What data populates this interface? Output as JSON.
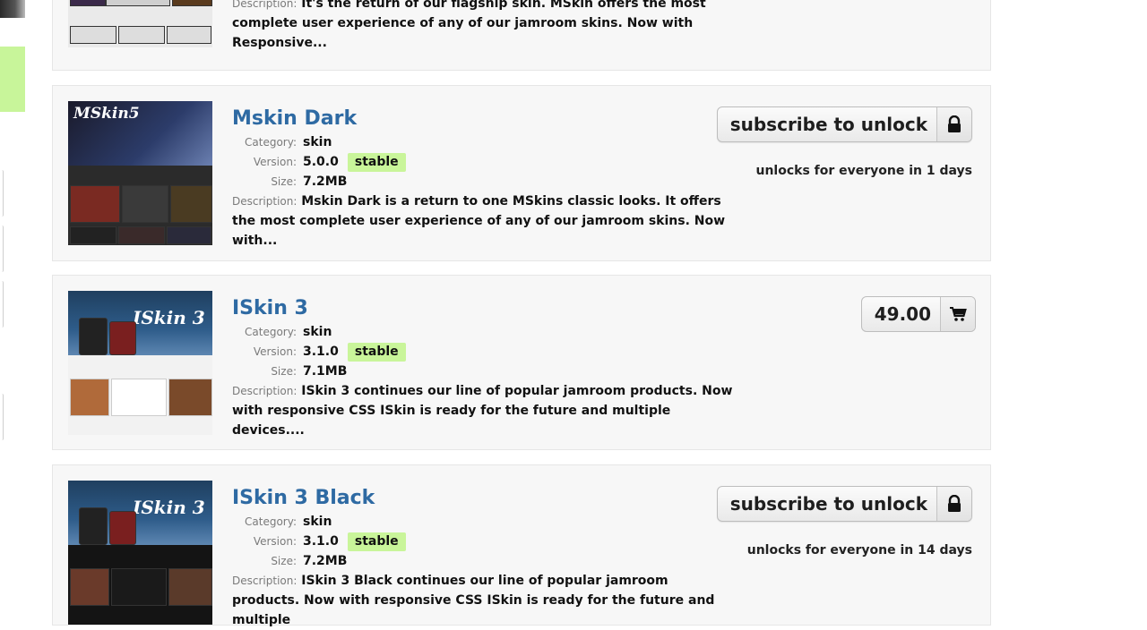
{
  "items": [
    {
      "description_label": "Description:",
      "description": "It's the return of our flagship skin. MSkin offers the most complete user experience of any of our jamroom skins. Now with Responsive..."
    },
    {
      "title": "Mskin Dark",
      "thumb_title": "MSkin5",
      "category_label": "Category:",
      "category": "skin",
      "version_label": "Version:",
      "version": "5.0.0",
      "status": "stable",
      "size_label": "Size:",
      "size": "7.2MB",
      "description_label": "Description:",
      "description": "Mskin Dark is a return to one MSkins classic looks. It offers the most complete user experience of any of our jamroom skins. Now with...",
      "action_label": "subscribe to unlock",
      "action_icon": "lock-icon",
      "unlock_note": "unlocks for everyone in 1 days"
    },
    {
      "title": "ISkin 3",
      "thumb_title": "ISkin 3",
      "category_label": "Category:",
      "category": "skin",
      "version_label": "Version:",
      "version": "3.1.0",
      "status": "stable",
      "size_label": "Size:",
      "size": "7.1MB",
      "description_label": "Description:",
      "description": "ISkin 3 continues our line of popular jamroom products. Now with responsive CSS ISkin is ready for the future and multiple devices....",
      "price": "49.00",
      "action_icon": "cart-icon"
    },
    {
      "title": "ISkin 3 Black",
      "thumb_title": "ISkin 3",
      "category_label": "Category:",
      "category": "skin",
      "version_label": "Version:",
      "version": "3.1.0",
      "status": "stable",
      "size_label": "Size:",
      "size": "7.2MB",
      "description_label": "Description:",
      "description": "ISkin 3 Black continues our line of popular jamroom products. Now with responsive CSS ISkin is ready for the future and multiple",
      "action_label": "subscribe to unlock",
      "action_icon": "lock-icon",
      "unlock_note": "unlocks for everyone in 14 days"
    }
  ],
  "colors": {
    "title": "#2e6aa3",
    "badge": "#c9f59a",
    "card_bg": "#f7f7f7"
  }
}
